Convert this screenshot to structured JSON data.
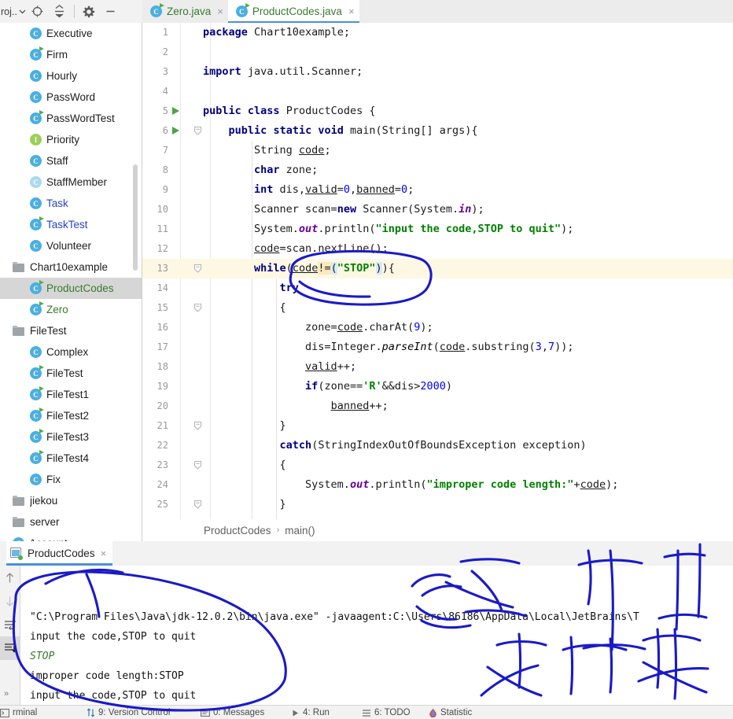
{
  "window": {
    "toolbar": {
      "project_label": "roj..",
      "icons": [
        "locate-icon",
        "collapse-all-icon",
        "settings-gear-icon",
        "minimize-icon"
      ]
    }
  },
  "tabs": [
    {
      "label": "Zero.java",
      "icon": "java-class-icon",
      "active": false,
      "close": "×"
    },
    {
      "label": "ProductCodes.java",
      "icon": "java-class-icon",
      "active": true,
      "close": "×"
    }
  ],
  "sidebar": {
    "items": [
      {
        "label": "Executive",
        "icon": "java-class-icon",
        "indent": 2,
        "color": "normal",
        "selected": false
      },
      {
        "label": "Firm",
        "icon": "java-class-run-icon",
        "indent": 2,
        "color": "normal",
        "selected": false
      },
      {
        "label": "Hourly",
        "icon": "java-class-icon",
        "indent": 2,
        "color": "normal",
        "selected": false
      },
      {
        "label": "PassWord",
        "icon": "java-class-icon",
        "indent": 2,
        "color": "normal",
        "selected": false
      },
      {
        "label": "PassWordTest",
        "icon": "java-class-run-icon",
        "indent": 2,
        "color": "normal",
        "selected": false
      },
      {
        "label": "Priority",
        "icon": "java-interface-icon",
        "indent": 2,
        "color": "normal",
        "selected": false
      },
      {
        "label": "Staff",
        "icon": "java-class-icon",
        "indent": 2,
        "color": "normal",
        "selected": false
      },
      {
        "label": "StaffMember",
        "icon": "java-abstract-class-icon",
        "indent": 2,
        "color": "normal",
        "selected": false
      },
      {
        "label": "Task",
        "icon": "java-class-icon",
        "indent": 2,
        "color": "blue",
        "selected": false
      },
      {
        "label": "TaskTest",
        "icon": "java-class-run-icon",
        "indent": 2,
        "color": "blue",
        "selected": false
      },
      {
        "label": "Volunteer",
        "icon": "java-class-icon",
        "indent": 2,
        "color": "normal",
        "selected": false
      },
      {
        "label": "Chart10example",
        "icon": "folder-icon",
        "indent": 1,
        "color": "normal",
        "selected": false
      },
      {
        "label": "ProductCodes",
        "icon": "java-class-run-icon",
        "indent": 2,
        "color": "green",
        "selected": true
      },
      {
        "label": "Zero",
        "icon": "java-class-run-icon",
        "indent": 2,
        "color": "green",
        "selected": false
      },
      {
        "label": "FileTest",
        "icon": "folder-icon",
        "indent": 1,
        "color": "normal",
        "selected": false
      },
      {
        "label": "Complex",
        "icon": "java-class-icon",
        "indent": 2,
        "color": "normal",
        "selected": false
      },
      {
        "label": "FileTest",
        "icon": "java-class-run-icon",
        "indent": 2,
        "color": "normal",
        "selected": false
      },
      {
        "label": "FileTest1",
        "icon": "java-class-run-icon",
        "indent": 2,
        "color": "normal",
        "selected": false
      },
      {
        "label": "FileTest2",
        "icon": "java-class-run-icon",
        "indent": 2,
        "color": "normal",
        "selected": false
      },
      {
        "label": "FileTest3",
        "icon": "java-class-run-icon",
        "indent": 2,
        "color": "normal",
        "selected": false
      },
      {
        "label": "FileTest4",
        "icon": "java-class-run-icon",
        "indent": 2,
        "color": "normal",
        "selected": false
      },
      {
        "label": "Fix",
        "icon": "java-class-icon",
        "indent": 2,
        "color": "normal",
        "selected": false
      },
      {
        "label": "jiekou",
        "icon": "folder-icon",
        "indent": 1,
        "color": "normal",
        "selected": false
      },
      {
        "label": "server",
        "icon": "folder-icon",
        "indent": 1,
        "color": "normal",
        "selected": false
      },
      {
        "label": "Account",
        "icon": "java-class-icon",
        "indent": 1,
        "color": "normal",
        "selected": false
      }
    ]
  },
  "editor": {
    "highlighted_line": 13,
    "run_marker_lines": [
      5,
      6
    ],
    "fold_lines": [
      6,
      13,
      15,
      21,
      23,
      25
    ],
    "lines": [
      {
        "n": 1,
        "text": "package Chart10example;"
      },
      {
        "n": 2,
        "text": ""
      },
      {
        "n": 3,
        "text": "import java.util.Scanner;"
      },
      {
        "n": 4,
        "text": ""
      },
      {
        "n": 5,
        "text": "public class ProductCodes {"
      },
      {
        "n": 6,
        "text": "    public static void main(String[] args){"
      },
      {
        "n": 7,
        "text": "        String code;"
      },
      {
        "n": 8,
        "text": "        char zone;"
      },
      {
        "n": 9,
        "text": "        int dis,valid=0,banned=0;"
      },
      {
        "n": 10,
        "text": "        Scanner scan=new Scanner(System.in);"
      },
      {
        "n": 11,
        "text": "        System.out.println(\"input the code,STOP to quit\");"
      },
      {
        "n": 12,
        "text": "        code=scan.nextLine();"
      },
      {
        "n": 13,
        "text": "        while(code!=(\"STOP\")){"
      },
      {
        "n": 14,
        "text": "            try"
      },
      {
        "n": 15,
        "text": "            {"
      },
      {
        "n": 16,
        "text": "                zone=code.charAt(9);"
      },
      {
        "n": 17,
        "text": "                dis=Integer.parseInt(code.substring(3,7));"
      },
      {
        "n": 18,
        "text": "                valid++;"
      },
      {
        "n": 19,
        "text": "                if(zone=='R'&&dis>2000)"
      },
      {
        "n": 20,
        "text": "                    banned++;"
      },
      {
        "n": 21,
        "text": "            }"
      },
      {
        "n": 22,
        "text": "            catch(StringIndexOutOfBoundsException exception)"
      },
      {
        "n": 23,
        "text": "            {"
      },
      {
        "n": 24,
        "text": "                System.out.println(\"improper code length:\"+code);"
      },
      {
        "n": 25,
        "text": "            }"
      }
    ]
  },
  "breadcrumb": {
    "class": "ProductCodes",
    "separator": "›",
    "method": "main()"
  },
  "run_panel": {
    "tab_label": "ProductCodes",
    "tab_close": "×",
    "gutter_icons": [
      "scroll-up-icon",
      "scroll-down-icon",
      "soft-wrap-icon",
      "scroll-to-end-icon"
    ],
    "console_lines": [
      {
        "text": "\"C:\\Program Files\\Java\\jdk-12.0.2\\bin\\java.exe\" -javaagent:C:\\Users\\86186\\AppData\\Local\\JetBrains\\T",
        "kind": "command"
      },
      {
        "text": "input the code,STOP to quit",
        "kind": "output"
      },
      {
        "text": "STOP",
        "kind": "user-input"
      },
      {
        "text": "improper code length:STOP",
        "kind": "output"
      },
      {
        "text": "input the code,STOP to quit",
        "kind": "output"
      },
      {
        "text": "",
        "kind": "caret"
      }
    ]
  },
  "status_bar": {
    "items": [
      {
        "label": "rminal",
        "icon": "terminal-icon"
      },
      {
        "label": "9: Version Control",
        "icon": "vcs-icon"
      },
      {
        "label": "0: Messages",
        "icon": "messages-icon"
      },
      {
        "label": "4: Run",
        "icon": "run-icon"
      },
      {
        "label": "6: TODO",
        "icon": "todo-icon"
      },
      {
        "label": "Statistic",
        "icon": "statistic-icon"
      }
    ],
    "expand_chevrons": "»"
  },
  "annotations": {
    "ink_color": "#1a1ac8",
    "shapes": [
      "ellipse-around-while-condition",
      "large-ellipse-around-console-output",
      "handwritten-chinese-notes"
    ]
  }
}
